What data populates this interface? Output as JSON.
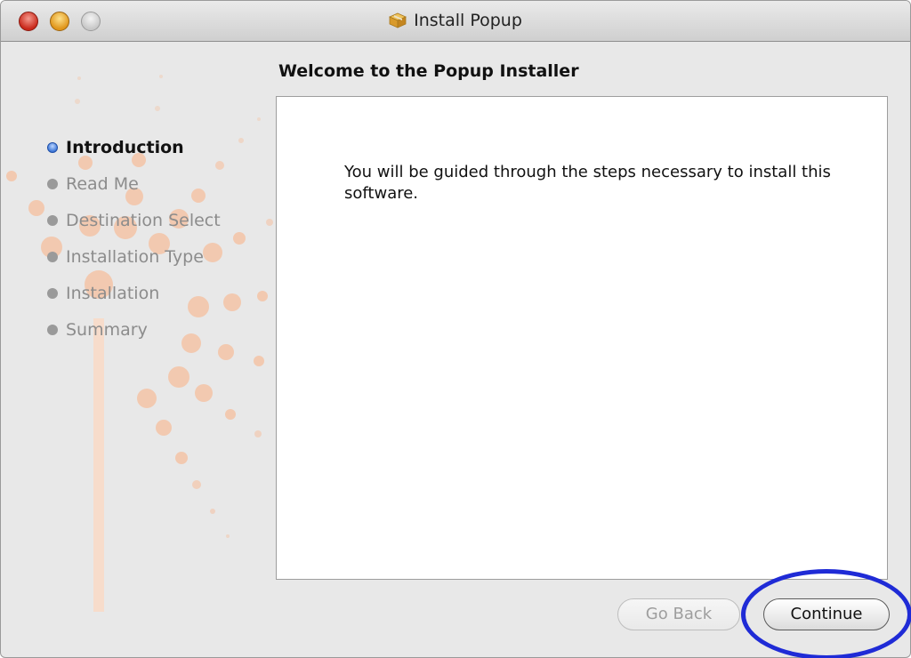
{
  "window": {
    "title": "Install Popup"
  },
  "heading": "Welcome to the Popup Installer",
  "steps": [
    {
      "label": "Introduction",
      "active": true
    },
    {
      "label": "Read Me",
      "active": false
    },
    {
      "label": "Destination Select",
      "active": false
    },
    {
      "label": "Installation Type",
      "active": false
    },
    {
      "label": "Installation",
      "active": false
    },
    {
      "label": "Summary",
      "active": false
    }
  ],
  "panel": {
    "body": "You will be guided through the steps necessary to install this software."
  },
  "buttons": {
    "back_label": "Go Back",
    "continue_label": "Continue"
  },
  "colors": {
    "active_step": "#3f78d8",
    "annotation_ring": "#1f2bd6",
    "dots": "#f2c9b0"
  }
}
